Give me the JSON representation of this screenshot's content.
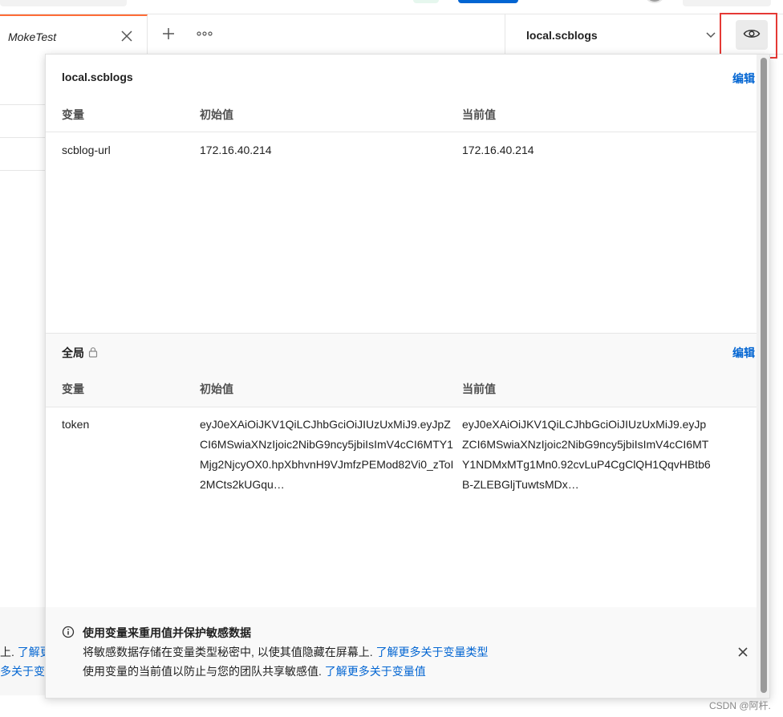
{
  "tab": {
    "label": "MokeTest"
  },
  "environment": {
    "selected": "local.scblogs"
  },
  "left_background": {
    "line1_prefix": "上.",
    "line1_link": "了解更",
    "line2_link": "多关于变"
  },
  "panel": {
    "env_section": {
      "title": "local.scblogs",
      "edit_label": "编辑",
      "headers": {
        "variable": "变量",
        "initial": "初始值",
        "current": "当前值"
      },
      "rows": [
        {
          "variable": "scblog-url",
          "initial": "172.16.40.214",
          "current": "172.16.40.214"
        }
      ]
    },
    "global_section": {
      "title": "全局",
      "edit_label": "编辑",
      "headers": {
        "variable": "变量",
        "initial": "初始值",
        "current": "当前值"
      },
      "rows": [
        {
          "variable": "token",
          "initial": "eyJ0eXAiOiJKV1QiLCJhbGciOiJIUzUxMiJ9.eyJpZCI6MSwiaXNzIjoic2NibG9ncy5jbiIsImV4cCI6MTY1Mjg2NjcyOX0.hpXbhvnH9VJmfzPEMod82Vi0_zToI2MCts2kUGqu…",
          "current": "eyJ0eXAiOiJKV1QiLCJhbGciOiJIUzUxMiJ9.eyJpZCI6MSwiaXNzIjoic2NibG9ncy5jbiIsImV4cCI6MTY1NDMxMTg1Mn0.92cvLuP4CgClQH1QqvHBtb6B-ZLEBGljTuwtsMDx…"
        }
      ]
    },
    "footer": {
      "title": "使用变量来重用值并保护敏感数据",
      "line1_text": "将敏感数据存储在变量类型秘密中, 以使其值隐藏在屏幕上.",
      "line1_link": "了解更多关于变量类型",
      "line2_text": "使用变量的当前值以防止与您的团队共享敏感值.",
      "line2_link": "了解更多关于变量值"
    }
  },
  "watermark": "CSDN @阿杆.",
  "colors": {
    "accent_link": "#0265d2",
    "tab_active": "#ff6c37",
    "highlight": "#e53935"
  },
  "icons": [
    "close-icon",
    "plus-icon",
    "more-icon",
    "chevron-down-icon",
    "eye-icon",
    "lock-icon",
    "info-icon"
  ]
}
